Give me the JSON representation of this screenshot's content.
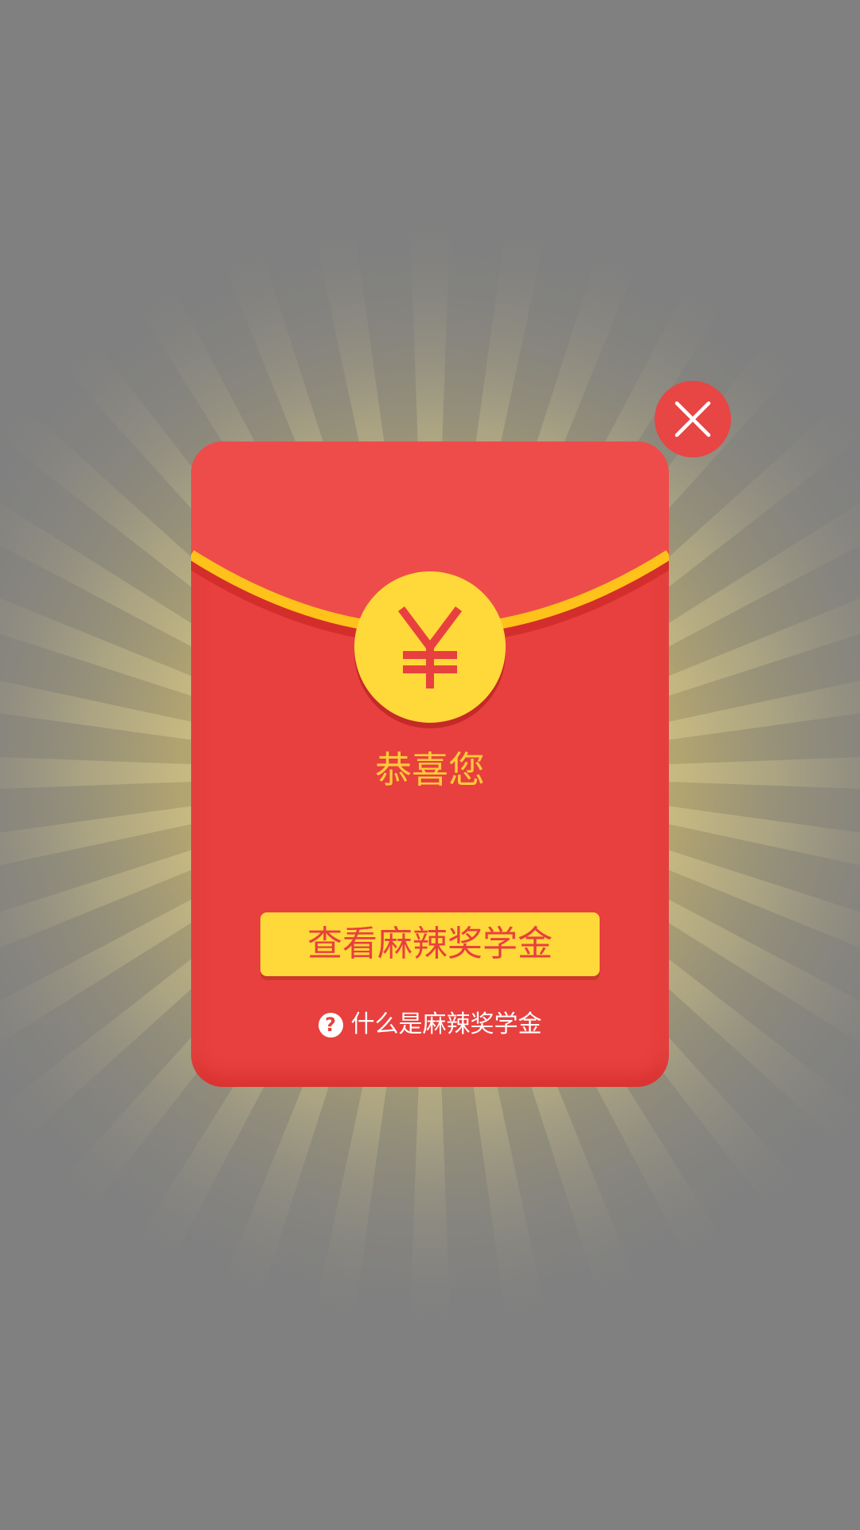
{
  "popup": {
    "close_icon": "close-icon",
    "coin_icon": "yen-icon",
    "congrats_text": "恭喜您",
    "view_button_label": "查看麻辣奖学金",
    "help_icon": "question-circle-icon",
    "help_link_text": "什么是麻辣奖学金"
  },
  "colors": {
    "overlay": "#808080",
    "envelope_red": "#E8403E",
    "flap_red": "#EE4C4A",
    "gold": "#FFD83A",
    "gold_text": "#FFC93A",
    "white": "#FFFFFF"
  }
}
